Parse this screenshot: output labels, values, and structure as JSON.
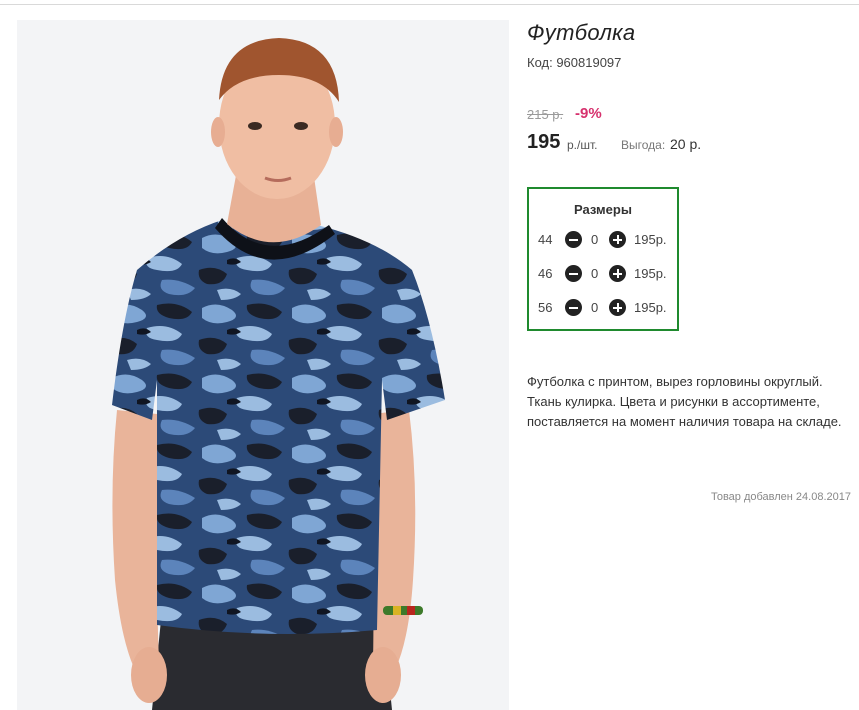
{
  "product": {
    "title": "Футболка",
    "code": "Код: 960819097",
    "old_price": "215 р.",
    "discount": "-9%",
    "price": "195",
    "price_unit": "р./шт.",
    "saving_label": "Выгода:",
    "saving_value": "20 р."
  },
  "sizes": {
    "title": "Размеры",
    "rows": [
      {
        "size": "44",
        "qty": "0",
        "price": "195р."
      },
      {
        "size": "46",
        "qty": "0",
        "price": "195р."
      },
      {
        "size": "56",
        "qty": "0",
        "price": "195р."
      }
    ],
    "minus_icon": "minus-circle-icon",
    "plus_icon": "plus-circle-icon",
    "accent_color": "#1f8a2e"
  },
  "description": "Футболка с принтом, вырез горловины округлый. Ткань кулирка. Цвета и рисунки в ассортименте, поставляется на момент наличия товара на складе.",
  "added": "Товар добавлен 24.08.2017",
  "colors": {
    "discount": "#d6316d",
    "frame": "#1f8a2e"
  }
}
